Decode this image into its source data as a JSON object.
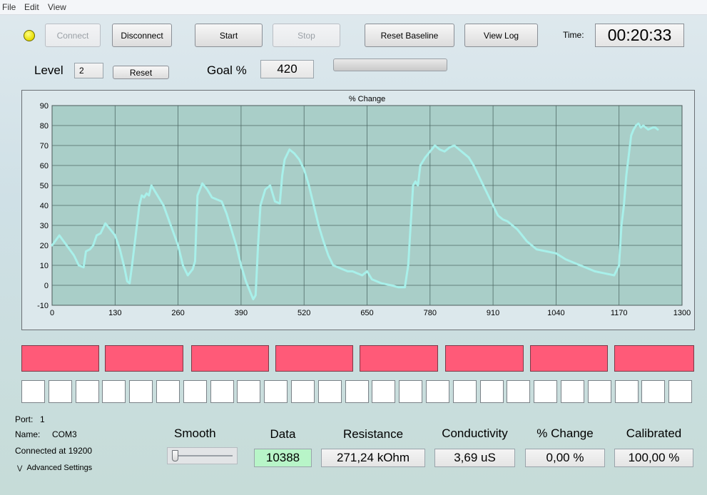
{
  "menu": {
    "file": "File",
    "edit": "Edit",
    "view": "View"
  },
  "toolbar": {
    "connect": "Connect",
    "disconnect": "Disconnect",
    "start": "Start",
    "stop": "Stop",
    "reset_baseline": "Reset Baseline",
    "view_log": "View Log",
    "time_label": "Time:",
    "time_value": "00:20:33"
  },
  "level": {
    "label": "Level",
    "value": "2",
    "reset": "Reset"
  },
  "goal": {
    "label": "Goal %",
    "value": "420"
  },
  "status_led_color": "#f2e600",
  "chart_data": {
    "type": "line",
    "title": "% Change",
    "xlim": [
      0,
      1300
    ],
    "ylim": [
      -10,
      90
    ],
    "x_ticks": [
      0,
      130,
      260,
      390,
      520,
      650,
      780,
      910,
      1040,
      1170,
      1300
    ],
    "y_ticks": [
      -10,
      0,
      10,
      20,
      30,
      40,
      50,
      60,
      70,
      80,
      90
    ],
    "grid": true,
    "line_color": "#a8f0ea",
    "plot_background": "#a9cec8",
    "x": [
      0,
      15,
      30,
      45,
      55,
      65,
      70,
      78,
      85,
      92,
      100,
      110,
      120,
      130,
      140,
      150,
      155,
      160,
      165,
      170,
      175,
      180,
      185,
      190,
      195,
      200,
      205,
      215,
      230,
      245,
      260,
      270,
      280,
      290,
      295,
      300,
      310,
      320,
      330,
      340,
      350,
      360,
      370,
      380,
      390,
      400,
      410,
      415,
      420,
      425,
      430,
      440,
      450,
      460,
      470,
      475,
      480,
      490,
      500,
      510,
      520,
      530,
      540,
      550,
      560,
      570,
      580,
      590,
      600,
      610,
      620,
      630,
      640,
      650,
      660,
      680,
      700,
      715,
      728,
      735,
      740,
      745,
      750,
      755,
      760,
      770,
      780,
      790,
      800,
      810,
      820,
      830,
      840,
      850,
      860,
      870,
      880,
      890,
      900,
      910,
      920,
      930,
      940,
      950,
      960,
      970,
      980,
      990,
      1000,
      1020,
      1040,
      1060,
      1080,
      1100,
      1120,
      1140,
      1160,
      1170,
      1175,
      1180,
      1185,
      1190,
      1195,
      1200,
      1205,
      1210,
      1215,
      1220,
      1230,
      1240,
      1245,
      1250,
      1260,
      1270
    ],
    "y": [
      20,
      25,
      20,
      15,
      10,
      9,
      17,
      18,
      20,
      25,
      26,
      31,
      28,
      25,
      18,
      8,
      2,
      1,
      10,
      20,
      30,
      40,
      45,
      44,
      46,
      45,
      50,
      46,
      40,
      30,
      20,
      10,
      5,
      8,
      12,
      45,
      51,
      48,
      44,
      43,
      42,
      36,
      28,
      20,
      10,
      2,
      -4,
      -7,
      -5,
      20,
      40,
      48,
      50,
      42,
      41,
      55,
      63,
      68,
      66,
      63,
      58,
      50,
      40,
      30,
      22,
      15,
      10,
      9,
      8,
      7,
      7,
      6,
      5,
      7,
      3,
      1,
      0,
      -1,
      -1,
      10,
      30,
      50,
      52,
      50,
      60,
      64,
      67,
      70,
      68,
      67,
      69,
      70,
      68,
      66,
      64,
      60,
      55,
      50,
      45,
      40,
      35,
      33,
      32,
      30,
      28,
      25,
      22,
      20,
      18,
      17,
      16,
      13,
      11,
      9,
      7,
      6,
      5,
      10,
      30,
      40,
      55,
      65,
      75,
      78,
      80,
      81,
      79,
      80,
      78,
      79,
      79,
      78
    ]
  },
  "blocks": {
    "red_count": 8,
    "white_count": 25,
    "red_color": "#ff5a78"
  },
  "port": {
    "port_label": "Port:",
    "port_value": "1",
    "name_label": "Name:",
    "name_value": "COM3",
    "connected": "Connected at 19200",
    "advanced": "Advanced Settings"
  },
  "readouts": {
    "smooth": "Smooth",
    "smooth_level": 0,
    "data_label": "Data",
    "data_value": "10388",
    "data_color": "#b8f5c8",
    "resistance_label": "Resistance",
    "resistance_value": "271,24 kOhm",
    "conductivity_label": "Conductivity",
    "conductivity_value": "3,69 uS",
    "change_label": "% Change",
    "change_value": "0,00 %",
    "calibrated_label": "Calibrated",
    "calibrated_value": "100,00 %"
  }
}
